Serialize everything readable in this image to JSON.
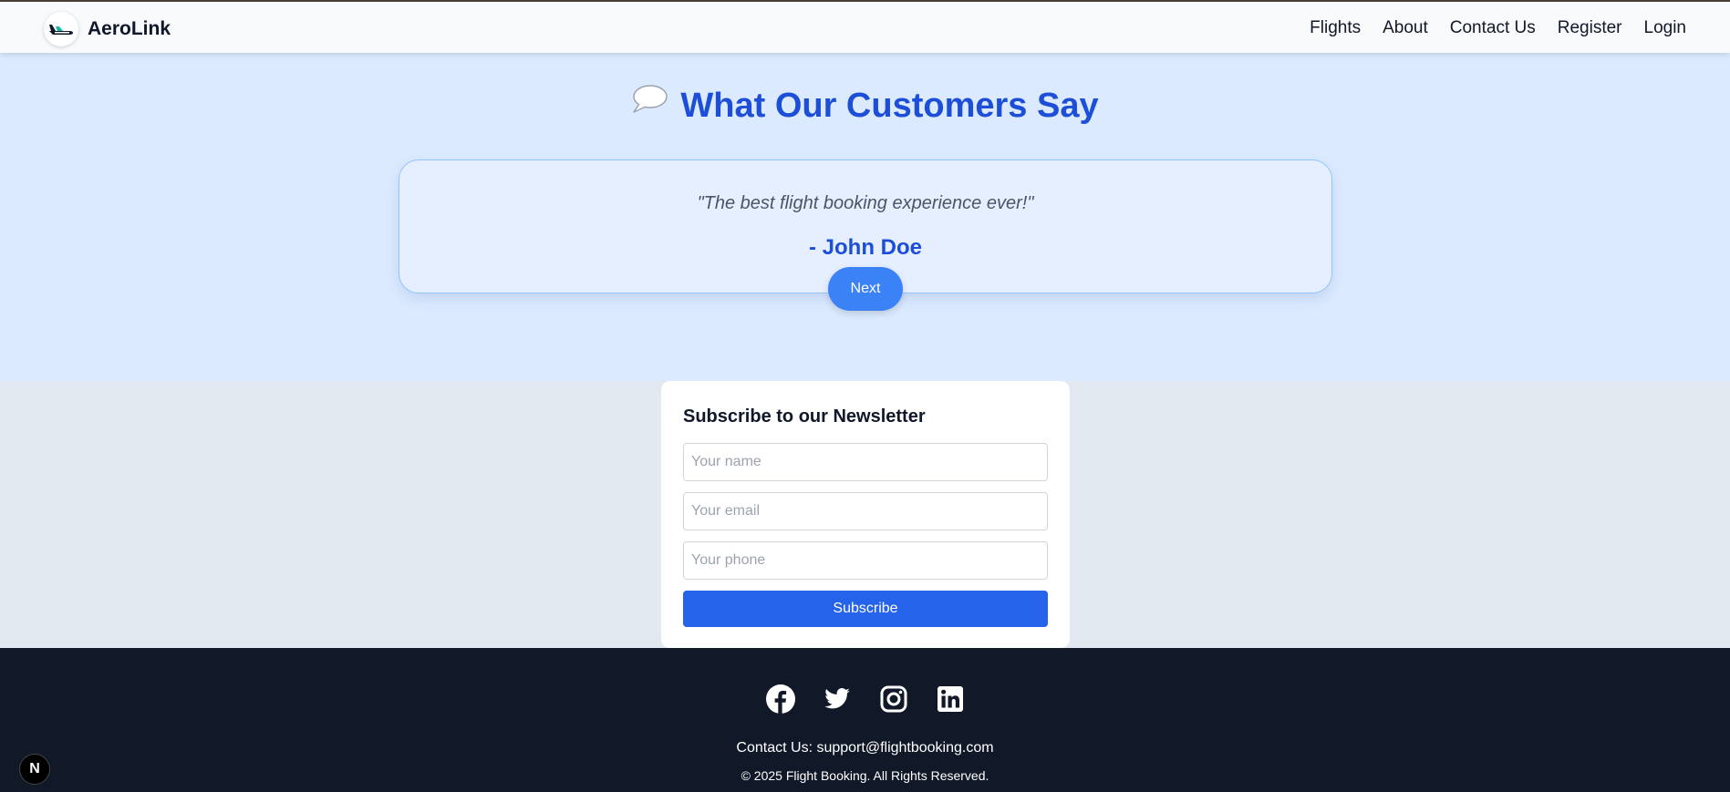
{
  "navbar": {
    "brand": "AeroLink",
    "links": [
      "Flights",
      "About",
      "Contact Us",
      "Register",
      "Login"
    ]
  },
  "testimonials": {
    "heading": "What Our Customers Say",
    "quote": "\"The best flight booking experience ever!\"",
    "author": "- John Doe",
    "next_label": "Next"
  },
  "newsletter": {
    "title": "Subscribe to our Newsletter",
    "name_placeholder": "Your name",
    "email_placeholder": "Your email",
    "phone_placeholder": "Your phone",
    "subscribe_label": "Subscribe"
  },
  "footer": {
    "socials": [
      "facebook-icon",
      "twitter-icon",
      "instagram-icon",
      "linkedin-icon"
    ],
    "contact": "Contact Us: support@flightbooking.com",
    "copyright": "© 2025 Flight Booking. All Rights Reserved."
  },
  "dev_badge": "N",
  "colors": {
    "accent": "#1d4ed8",
    "button_blue": "#2563eb",
    "next_blue": "#3b82f6",
    "footer_bg": "#111827",
    "testimonial_bg": "#dbeafe"
  }
}
